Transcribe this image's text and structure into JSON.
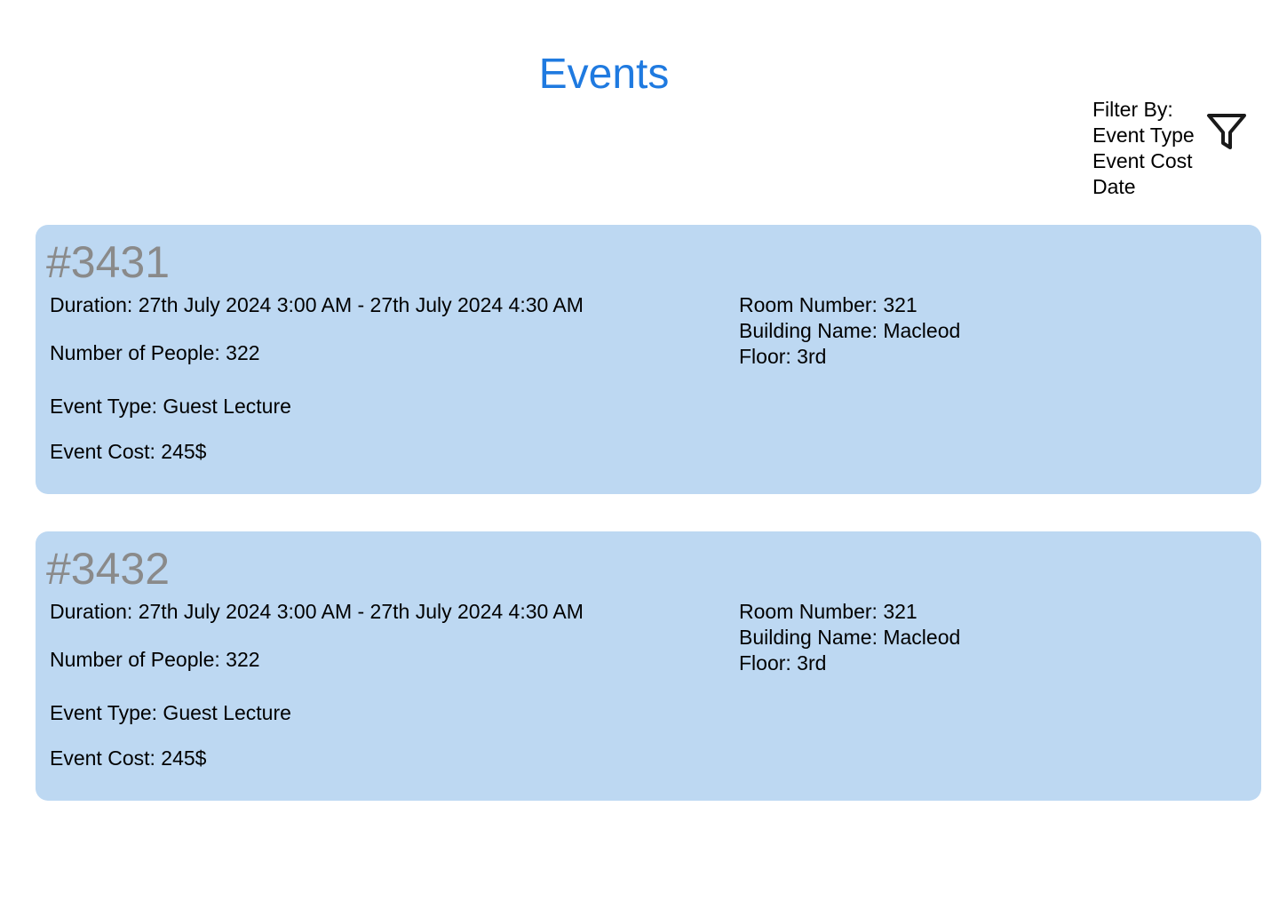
{
  "page": {
    "title": "Events"
  },
  "filter": {
    "label": "Filter By:",
    "options": [
      "Event Type",
      "Event Cost",
      "Date"
    ],
    "icon": "funnel-icon"
  },
  "events": [
    {
      "id": "#3431",
      "duration": "Duration: 27th July 2024 3:00 AM - 27th July 2024 4:30 AM",
      "people": "Number of People: 322",
      "type": "Event Type: Guest Lecture",
      "cost": "Event Cost: 245$",
      "room": "Room Number: 321",
      "building": "Building Name: Macleod",
      "floor": "Floor: 3rd"
    },
    {
      "id": "#3432",
      "duration": "Duration: 27th July 2024 3:00 AM - 27th July 2024 4:30 AM",
      "people": "Number of People: 322",
      "type": "Event Type: Guest Lecture",
      "cost": "Event Cost: 245$",
      "room": "Room Number: 321",
      "building": "Building Name: Macleod",
      "floor": "Floor: 3rd"
    }
  ],
  "colors": {
    "title": "#1f7ae0",
    "card_background": "#bdd8f2",
    "event_id": "#8a8a8a"
  }
}
